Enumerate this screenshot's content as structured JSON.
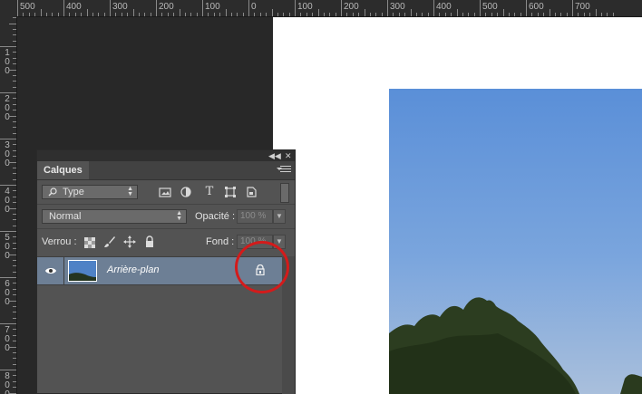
{
  "ruler": {
    "horizontal_labels": [
      "500",
      "400",
      "300",
      "200",
      "100",
      "0",
      "100",
      "200",
      "300",
      "400",
      "500",
      "600",
      "700"
    ],
    "vertical_labels": [
      [
        "1",
        "0",
        "0"
      ],
      [
        "2",
        "0",
        "0"
      ],
      [
        "3",
        "0",
        "0"
      ],
      [
        "4",
        "0",
        "0"
      ],
      [
        "5",
        "0",
        "0"
      ],
      [
        "6",
        "0",
        "0"
      ],
      [
        "7",
        "0",
        "0"
      ],
      [
        "8",
        "0",
        "0"
      ]
    ]
  },
  "panel": {
    "collapse_icon": "double-chevron-left",
    "close_icon": "close-x",
    "tab_label": "Calques",
    "filter": {
      "kind_label": "Type",
      "search_icon": "magnifier-icon",
      "filter_icons": [
        "image-filter-icon",
        "adjustment-filter-icon",
        "type-filter-icon",
        "shape-filter-icon",
        "smart-object-filter-icon"
      ]
    },
    "blend_mode": "Normal",
    "opacity": {
      "label": "Opacité :",
      "value": "100 %"
    },
    "lock": {
      "label": "Verrou :",
      "icons": [
        "lock-transparent-icon",
        "lock-paint-icon",
        "lock-move-icon",
        "lock-all-icon"
      ]
    },
    "fill": {
      "label": "Fond :",
      "value": "100 %"
    },
    "layers": [
      {
        "name": "Arrière-plan",
        "visible": true,
        "locked": true
      }
    ]
  },
  "highlight_color": "#d31b1b",
  "selection_color": "#6d7f95"
}
